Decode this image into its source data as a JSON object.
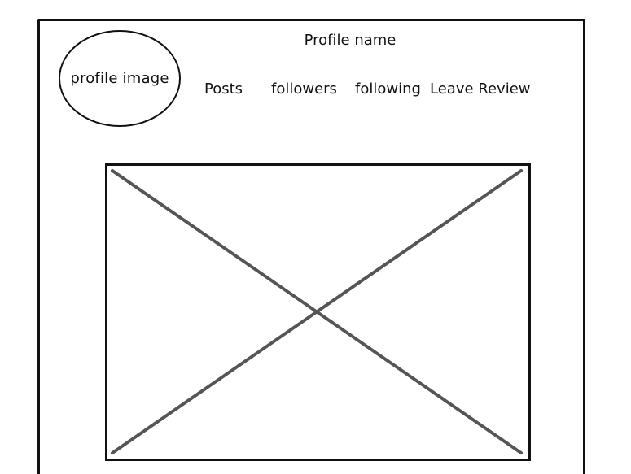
{
  "header": {
    "profile_image_label": "profile image",
    "profile_name": "Profile name"
  },
  "nav": {
    "posts": "Posts",
    "followers": "followers",
    "following": "following",
    "leave_review": "Leave Review"
  },
  "colors": {
    "stroke": "#111111",
    "placeholder_cross": "#555555",
    "background": "#ffffff"
  },
  "placeholder": {
    "icon": "image-placeholder-cross-icon"
  }
}
